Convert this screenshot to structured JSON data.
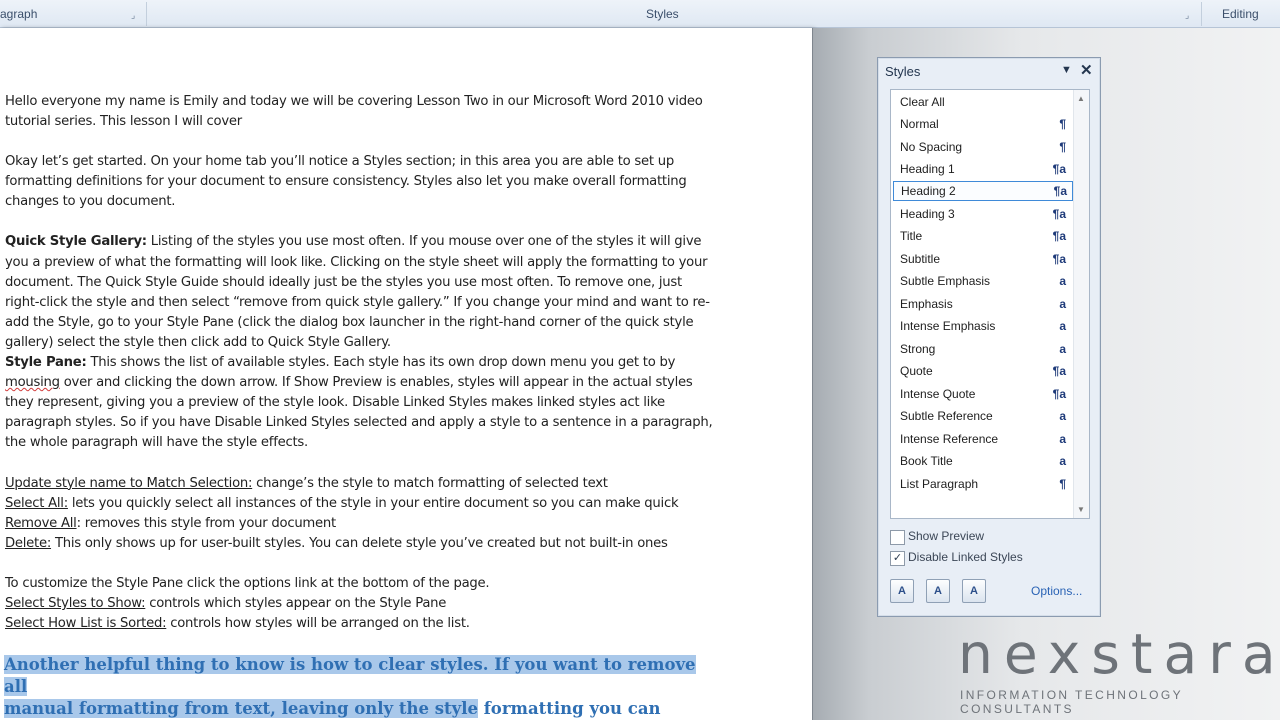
{
  "ribbon": {
    "groups": {
      "paragraph": "agraph",
      "styles": "Styles",
      "editing": "Editing"
    }
  },
  "document": {
    "p1": "Hello everyone my name is Emily and today we will be covering Lesson Two in our Microsoft Word 2010 video tutorial series. This lesson I will cover",
    "p2": "Okay let’s get started. On your home tab you’ll notice a Styles section; in this area you are able to set up formatting definitions for your document to ensure consistency. Styles also let you make overall formatting changes to you document.",
    "qsg_label": "Quick Style Gallery:",
    "qsg_text": " Listing of the styles you use most often. If you mouse over one of the styles it will give you a preview of what the formatting will look like. Clicking on the style sheet will apply the formatting to your document. The Quick Style Guide should ideally just be the styles you use most often. To remove one, just right-click the style and then select “remove from quick style gallery.” If you change your mind and want to re-add the Style, go to your Style Pane (click the dialog box launcher in the right-hand corner of the quick style gallery) select the style then click add to Quick Style Gallery.",
    "sp_label": "Style Pane:",
    "sp_text1": " This shows the list of available  styles. Each style has its own drop down menu you get to by ",
    "sp_misspelled": "mousing",
    "sp_text2": " over and clicking the down arrow. If Show Preview is enables, styles will appear in the actual styles they represent, giving you a preview of the style look. Disable Linked Styles makes linked styles act like paragraph styles. So if you have Disable Linked Styles selected and apply a style to a sentence in a paragraph, the whole paragraph will have the style effects.",
    "upd_label": "Update style name to Match Selection:",
    "upd_text": " change’s the style to match formatting of selected text",
    "sel_label": "Select All:",
    "sel_text": "  lets you quickly select all instances of the style in your entire document so you can make quick",
    "rem_label": "Remove All",
    "rem_text": ": removes this style from your document",
    "del_label": "Delete:",
    "del_text": " This only shows up for user-built styles. You can delete style you’ve created but not built-in ones",
    "cust_text": "To customize the Style Pane click the options link at the bottom of the page.",
    "sss_label": "Select Styles to Show:",
    "sss_text": " controls which styles appear on the Style Pane",
    "shl_label": "Select How List is Sorted:",
    "shl_text": " controls how styles will be arranged on the list.",
    "hl_line1": "Another helpful thing to know is how to clear styles. If you want to remove all",
    "hl_line2a": "manual formatting from text, leaving only the style",
    "hl_line2b": " formatting you can either"
  },
  "styles_pane": {
    "title": "Styles",
    "menu_icon": "dropdown-arrow",
    "close_icon": "close-x",
    "items": [
      {
        "name": "Clear All",
        "mark": ""
      },
      {
        "name": "Normal",
        "mark": "¶"
      },
      {
        "name": "No Spacing",
        "mark": "¶"
      },
      {
        "name": "Heading 1",
        "mark": "¶a"
      },
      {
        "name": "Heading 2",
        "mark": "¶a"
      },
      {
        "name": "Heading 3",
        "mark": "¶a"
      },
      {
        "name": "Title",
        "mark": "¶a"
      },
      {
        "name": "Subtitle",
        "mark": "¶a"
      },
      {
        "name": "Subtle Emphasis",
        "mark": "a"
      },
      {
        "name": "Emphasis",
        "mark": "a"
      },
      {
        "name": "Intense Emphasis",
        "mark": "a"
      },
      {
        "name": "Strong",
        "mark": "a"
      },
      {
        "name": "Quote",
        "mark": "¶a"
      },
      {
        "name": "Intense Quote",
        "mark": "¶a"
      },
      {
        "name": "Subtle Reference",
        "mark": "a"
      },
      {
        "name": "Intense Reference",
        "mark": "a"
      },
      {
        "name": "Book Title",
        "mark": "a"
      },
      {
        "name": "List Paragraph",
        "mark": "¶"
      }
    ],
    "selected_item": "Heading 2",
    "show_preview": {
      "label": "Show Preview",
      "checked": false
    },
    "disable_linked": {
      "label": "Disable Linked Styles",
      "checked": true
    },
    "buttons": {
      "new_style": "A",
      "style_inspector": "A",
      "manage_styles": "A"
    },
    "options_label": "Options..."
  },
  "logo": {
    "name": "nexstara",
    "tagline": "INFORMATION TECHNOLOGY CONSULTANTS"
  }
}
